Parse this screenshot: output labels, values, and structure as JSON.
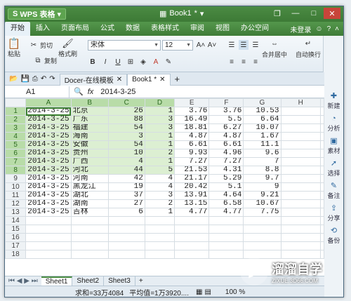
{
  "app": {
    "name": "WPS 表格",
    "logo_letter": "S",
    "doc_title": "Book1",
    "doc_suffix": "*"
  },
  "menu": {
    "tabs": [
      "开始",
      "插入",
      "页面布局",
      "公式",
      "数据",
      "表格样式",
      "审阅",
      "视图",
      "办公空间"
    ],
    "login": "未登录"
  },
  "ribbon": {
    "paste": "粘贴",
    "cut": "剪切",
    "copy": "复制",
    "format_painter": "格式刷",
    "font_name": "宋体",
    "font_size": "12",
    "merge_center": "合并居中",
    "wrap_text": "自动换行"
  },
  "right_panel": [
    "新建",
    "分析",
    "素材",
    "选择",
    "备注",
    "分享",
    "备份"
  ],
  "doc_tabs": [
    {
      "label": "Docer-在线模板"
    },
    {
      "label": "Book1 *"
    }
  ],
  "formula": {
    "cell_ref": "A1",
    "fx": "fx",
    "value": "2014-3-25"
  },
  "grid": {
    "columns": [
      "A",
      "B",
      "C",
      "D",
      "E",
      "F",
      "G",
      "H"
    ],
    "rows": [
      [
        "2014-3-25",
        "北京",
        "26",
        "1",
        "3.76",
        "3.76",
        "10.53",
        ""
      ],
      [
        "2014-3-25",
        "广东",
        "88",
        "3",
        "16.49",
        "5.5",
        "6.64",
        ""
      ],
      [
        "2014-3-25",
        "福建",
        "54",
        "3",
        "18.81",
        "6.27",
        "10.07",
        ""
      ],
      [
        "2014-3-25",
        "海南",
        "3",
        "1",
        "4.87",
        "4.87",
        "1.67",
        ""
      ],
      [
        "2014-3-25",
        "安徽",
        "54",
        "1",
        "6.61",
        "6.61",
        "11.1",
        ""
      ],
      [
        "2014-3-25",
        "贵州",
        "10",
        "2",
        "9.93",
        "4.96",
        "9.6",
        ""
      ],
      [
        "2014-3-25",
        "广西",
        "4",
        "1",
        "7.27",
        "7.27",
        "7",
        ""
      ],
      [
        "2014-3-25",
        "河北",
        "44",
        "5",
        "21.53",
        "4.31",
        "8.8",
        ""
      ],
      [
        "2014-3-25",
        "河南",
        "42",
        "4",
        "21.17",
        "5.29",
        "9.7",
        ""
      ],
      [
        "2014-3-25",
        "黑龙江",
        "19",
        "4",
        "20.42",
        "5.1",
        "9",
        ""
      ],
      [
        "2014-3-25",
        "湖北",
        "37",
        "3",
        "13.91",
        "4.64",
        "9.21",
        ""
      ],
      [
        "2014-3-25",
        "湖南",
        "27",
        "2",
        "13.15",
        "6.58",
        "10.67",
        ""
      ],
      [
        "2014-3-25",
        "吉林",
        "6",
        "1",
        "4.77",
        "4.77",
        "7.75",
        ""
      ],
      [
        "",
        "",
        "",
        "",
        "",
        "",
        "",
        ""
      ],
      [
        "",
        "",
        "",
        "",
        "",
        "",
        "",
        ""
      ],
      [
        "",
        "",
        "",
        "",
        "",
        "",
        "",
        ""
      ],
      [
        "",
        "",
        "",
        "",
        "",
        "",
        "",
        ""
      ],
      [
        "",
        "",
        "",
        "",
        "",
        "",
        "",
        ""
      ]
    ],
    "selected_rows": 8,
    "selected_cols": 4
  },
  "sheets": [
    "Sheet1",
    "Sheet2",
    "Sheet3"
  ],
  "status": {
    "sum": "求和=33万4084",
    "avg": "平均值=1万3920....",
    "zoom": "100 %"
  },
  "watermark": {
    "title": "溜溜自学",
    "url": "ZIXUE.3D66.COM"
  },
  "colors": {
    "accent": "#4a8c41",
    "selection": "#dcefd2",
    "header_highlight": "#b8dca8"
  }
}
